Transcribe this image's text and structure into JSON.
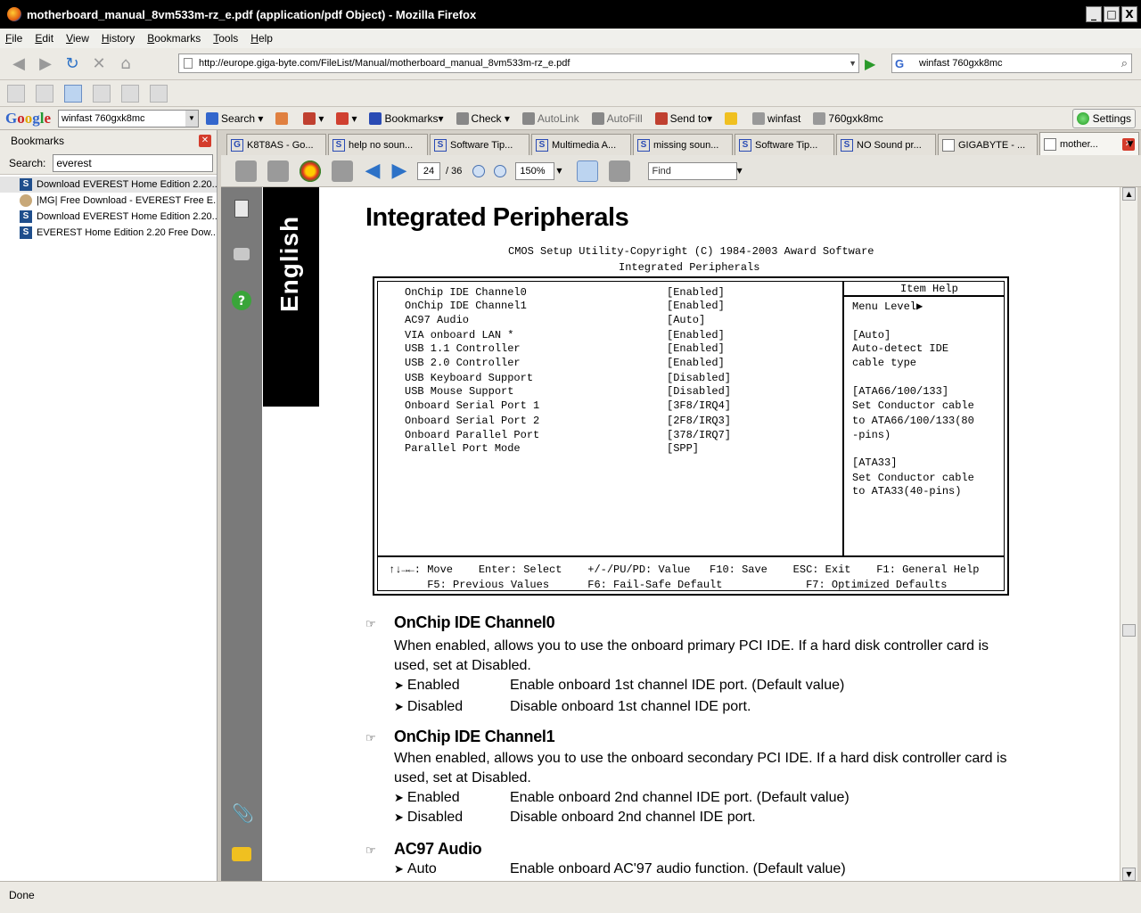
{
  "window": {
    "title": "motherboard_manual_8vm533m-rz_e.pdf (application/pdf Object) - Mozilla Firefox",
    "controls": [
      "_",
      "□",
      "X"
    ]
  },
  "menu": [
    "File",
    "Edit",
    "View",
    "History",
    "Bookmarks",
    "Tools",
    "Help"
  ],
  "nav": {
    "url": "http://europe.giga-byte.com/FileList/Manual/motherboard_manual_8vm533m-rz_e.pdf",
    "search_value": "winfast 760gxk8mc"
  },
  "google_toolbar": {
    "search_value": "winfast 760gxk8mc",
    "search_label": "Search",
    "bookmarks_label": "Bookmarks",
    "check_label": "Check",
    "autolink_label": "AutoLink",
    "autofill_label": "AutoFill",
    "sendto_label": "Send to",
    "term1": "winfast",
    "term2": "760gxk8mc",
    "settings_label": "Settings"
  },
  "sidebar": {
    "header": "Bookmarks",
    "search_label": "Search:",
    "search_value": "everest",
    "items": [
      {
        "label": "Download EVEREST Home Edition 2.20...",
        "icon": "S"
      },
      {
        "label": "|MG| Free Download - EVEREST Free E...",
        "icon": "MG"
      },
      {
        "label": "Download EVEREST Home Edition 2.20...",
        "icon": "S"
      },
      {
        "label": "EVEREST Home Edition 2.20 Free Dow...",
        "icon": "S"
      }
    ]
  },
  "tabs": [
    {
      "label": "K8T8AS - Go..."
    },
    {
      "label": "help no soun..."
    },
    {
      "label": "Software Tip..."
    },
    {
      "label": "Multimedia A..."
    },
    {
      "label": "missing soun..."
    },
    {
      "label": "Software Tip..."
    },
    {
      "label": "NO Sound pr..."
    },
    {
      "label": "GIGABYTE - ..."
    },
    {
      "label": "mother..."
    }
  ],
  "pdf_toolbar": {
    "page": "24",
    "total": "/ 36",
    "zoom": "150%",
    "find_placeholder": "Find"
  },
  "pdf": {
    "side_tab": "English",
    "title": "Integrated Peripherals",
    "cmos_line1": "CMOS Setup Utility-Copyright (C) 1984-2003 Award Software",
    "cmos_line2": "Integrated Peripherals",
    "bios_rows": [
      {
        "k": "OnChip IDE Channel0",
        "v": "[Enabled]"
      },
      {
        "k": "OnChip IDE Channel1",
        "v": "[Enabled]"
      },
      {
        "k": "AC97 Audio",
        "v": "[Auto]"
      },
      {
        "k": "VIA onboard LAN *",
        "v": "[Enabled]"
      },
      {
        "k": "USB 1.1 Controller",
        "v": "[Enabled]"
      },
      {
        "k": "USB 2.0 Controller",
        "v": "[Enabled]"
      },
      {
        "k": "USB Keyboard Support",
        "v": "[Disabled]"
      },
      {
        "k": "USB Mouse Support",
        "v": "[Disabled]"
      },
      {
        "k": "Onboard Serial Port 1",
        "v": "[3F8/IRQ4]"
      },
      {
        "k": "Onboard Serial Port 2",
        "v": "[2F8/IRQ3]"
      },
      {
        "k": "Onboard Parallel Port",
        "v": "[378/IRQ7]"
      },
      {
        "k": "Parallel Port Mode",
        "v": "[SPP]"
      }
    ],
    "help_title": "Item Help",
    "help_lines": [
      "Menu Level▶",
      "",
      "[Auto]",
      "Auto-detect IDE",
      "cable type",
      "",
      "[ATA66/100/133]",
      "Set Conductor cable",
      "to ATA66/100/133(80",
      "-pins)",
      "",
      "[ATA33]",
      "Set Conductor cable",
      "to ATA33(40-pins)"
    ],
    "footer_line1": "↑↓→←: Move    Enter: Select    +/-/PU/PD: Value   F10: Save    ESC: Exit    F1: General Help",
    "footer_line2": "      F5: Previous Values      F6: Fail-Safe Default             F7: Optimized Defaults",
    "sections": [
      {
        "heading": "OnChip IDE Channel0",
        "body": "When enabled, allows you to use the onboard primary PCI IDE.  If a hard disk controller card is used,  set at Disabled.",
        "options": [
          {
            "name": "Enabled",
            "desc": "Enable onboard 1st channel IDE port. (Default value)"
          },
          {
            "name": "Disabled",
            "desc": "Disable onboard 1st channel IDE port."
          }
        ]
      },
      {
        "heading": "OnChip IDE Channel1",
        "body": "When enabled, allows you to use the onboard secondary PCI IDE.  If a hard disk controller card is used,  set at Disabled.",
        "options": [
          {
            "name": "Enabled",
            "desc": "Enable onboard 2nd channel IDE port. (Default value)"
          },
          {
            "name": "Disabled",
            "desc": "Disable onboard 2nd channel IDE port."
          }
        ]
      },
      {
        "heading": "AC97 Audio",
        "body": "",
        "options": [
          {
            "name": "Auto",
            "desc": "Enable onboard AC'97 audio function. (Default value)"
          }
        ]
      }
    ]
  },
  "status": "Done"
}
